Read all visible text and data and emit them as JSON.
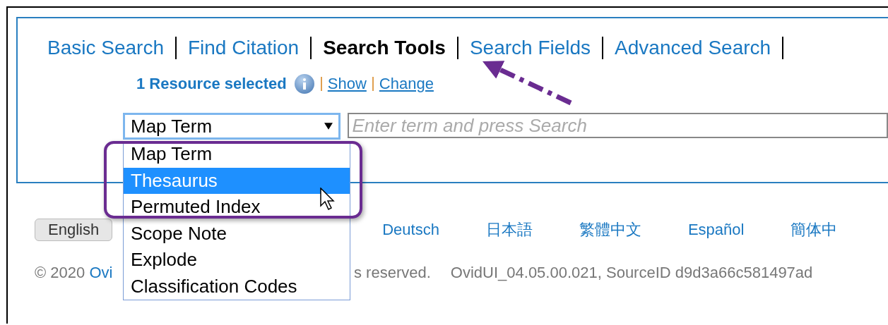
{
  "tabs": [
    {
      "label": "Basic Search",
      "selected": false
    },
    {
      "label": "Find Citation",
      "selected": false
    },
    {
      "label": "Search Tools",
      "selected": true
    },
    {
      "label": "Search Fields",
      "selected": false
    },
    {
      "label": "Advanced Search",
      "selected": false
    }
  ],
  "resources": {
    "status": "1 Resource selected",
    "links": [
      "Show",
      "Change"
    ]
  },
  "search": {
    "select_value": "Map Term",
    "placeholder": "Enter term and press Search"
  },
  "dropdown_options": [
    {
      "label": "Map Term",
      "selected": false
    },
    {
      "label": "Thesaurus",
      "selected": true
    },
    {
      "label": "Permuted Index",
      "selected": false
    },
    {
      "label": "Scope Note",
      "selected": false
    },
    {
      "label": "Explode",
      "selected": false
    },
    {
      "label": "Classification Codes",
      "selected": false
    }
  ],
  "languages": [
    {
      "label": "English",
      "selected": true
    },
    {
      "label": "Deutsch",
      "selected": false
    },
    {
      "label": "日本語",
      "selected": false
    },
    {
      "label": "繁體中文",
      "selected": false
    },
    {
      "label": "Español",
      "selected": false
    },
    {
      "label": "簡体中",
      "selected": false
    }
  ],
  "footer": {
    "copyright": "© 2020 ",
    "company_link": "Ovi",
    "rights": "s reserved.",
    "version": "OvidUI_04.05.00.021, SourceID d9d3a66c581497ad"
  }
}
